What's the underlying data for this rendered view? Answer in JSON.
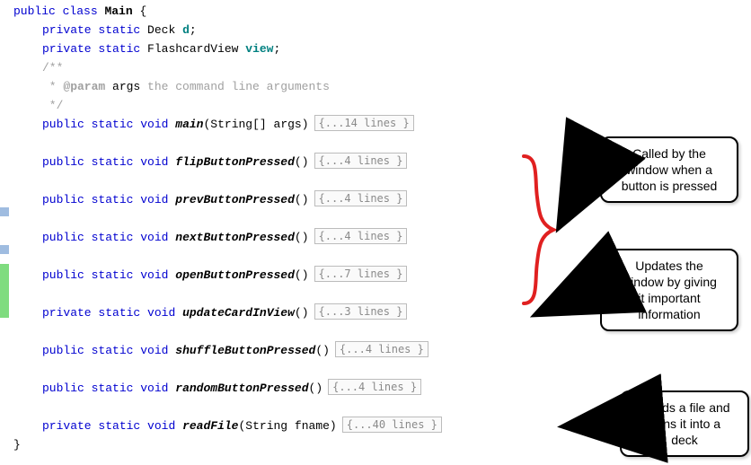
{
  "code": {
    "class_decl": {
      "public": "public",
      "class": "class",
      "name": "Main",
      "brace": " {"
    },
    "field1": {
      "vis": "private",
      "static": "static",
      "type": "Deck",
      "name": "d",
      "end": ";"
    },
    "field2": {
      "vis": "private",
      "static": "static",
      "type": "FlashcardView",
      "name": "view",
      "end": ";"
    },
    "doc_open": "/**",
    "doc_param_star": " * ",
    "doc_param_tag": "@param",
    "doc_param_name": " args ",
    "doc_param_desc": "the command line arguments",
    "doc_close": " */",
    "m_main": {
      "vis": "public",
      "static": "static",
      "ret": "void",
      "name": "main",
      "params": "(String[] args)",
      "fold": "{...14 lines }"
    },
    "m_flip": {
      "vis": "public",
      "static": "static",
      "ret": "void",
      "name": "flipButtonPressed",
      "params": "()",
      "fold": "{...4 lines }"
    },
    "m_prev": {
      "vis": "public",
      "static": "static",
      "ret": "void",
      "name": "prevButtonPressed",
      "params": "()",
      "fold": "{...4 lines }"
    },
    "m_next": {
      "vis": "public",
      "static": "static",
      "ret": "void",
      "name": "nextButtonPressed",
      "params": "()",
      "fold": "{...4 lines }"
    },
    "m_open": {
      "vis": "public",
      "static": "static",
      "ret": "void",
      "name": "openButtonPressed",
      "params": "()",
      "fold": "{...7 lines }"
    },
    "m_update": {
      "vis": "private",
      "static": "static",
      "ret": "void",
      "name": "updateCardInView",
      "params": "()",
      "fold": "{...3 lines }"
    },
    "m_shuffle": {
      "vis": "public",
      "static": "static",
      "ret": "void",
      "name": "shuffleButtonPressed",
      "params": "()",
      "fold": "{...4 lines }"
    },
    "m_random": {
      "vis": "public",
      "static": "static",
      "ret": "void",
      "name": "randomButtonPressed",
      "params": "()",
      "fold": "{...4 lines }"
    },
    "m_read": {
      "vis": "private",
      "static": "static",
      "ret": "void",
      "name": "readFile",
      "params": "(String fname)",
      "fold": "{...40 lines }"
    },
    "close_brace": "}"
  },
  "callouts": {
    "c1": "Called by the\nwindow when a\nbutton is pressed",
    "c2": "Updates the\nwindow by giving\nit important\ninformation",
    "c3": "Reads a file and\nturns it into a\ndeck"
  }
}
